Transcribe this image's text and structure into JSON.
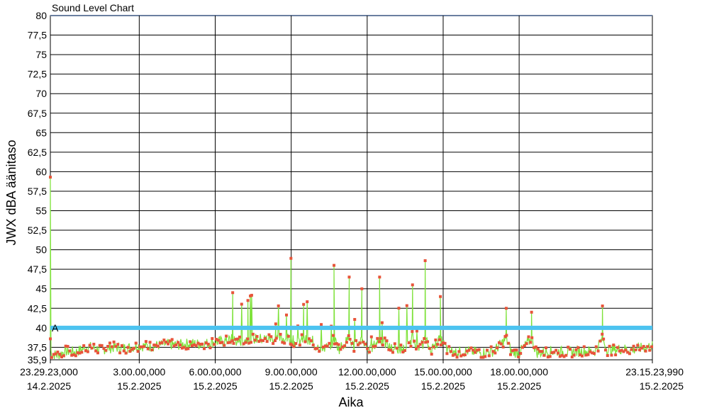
{
  "chart_data": {
    "type": "line",
    "title": "Sound Level Chart",
    "xlabel": "Aika",
    "ylabel": "JWX dBA äänitaso",
    "ylim": [
      35.9,
      80
    ],
    "y_ticks": [
      "80",
      "77,5",
      "75",
      "72,5",
      "70",
      "67,5",
      "65",
      "62,5",
      "60",
      "57,5",
      "55",
      "52,5",
      "50",
      "47,5",
      "45",
      "42,5",
      "40",
      "37,5",
      "35,9"
    ],
    "x_ticks": [
      {
        "time": "23.29.23,000",
        "date": "14.2.2025"
      },
      {
        "time": "3.00.00,000",
        "date": "15.2.2025"
      },
      {
        "time": "6.00.00,000",
        "date": "15.2.2025"
      },
      {
        "time": "9.00.00,000",
        "date": "15.2.2025"
      },
      {
        "time": "12.00.00,000",
        "date": "15.2.2025"
      },
      {
        "time": "15.00.00,000",
        "date": "15.2.2025"
      },
      {
        "time": "18.00.00,000",
        "date": "15.2.2025"
      },
      {
        "time": "23.15.23,990",
        "date": "15.2.2025"
      }
    ],
    "x_range_hours": [
      "23:29:23 14.2.2025",
      "23:15:24 15.2.2025"
    ],
    "grid": true,
    "threshold": {
      "label": "A",
      "value": 40,
      "color": "#4cc3f0"
    },
    "series": [
      {
        "color": "#7ee23a",
        "marker_color": "#e8543a",
        "values_description": "sampled dBA levels",
        "points": [
          [
            0.0,
            59.3
          ],
          [
            0.03,
            36.8
          ],
          [
            0.1,
            36.6
          ],
          [
            0.3,
            36.5
          ],
          [
            0.6,
            37.0
          ],
          [
            1.0,
            36.9
          ],
          [
            1.5,
            37.6
          ],
          [
            2.0,
            37.2
          ],
          [
            2.5,
            37.5
          ],
          [
            3.0,
            37.4
          ],
          [
            3.5,
            37.7
          ],
          [
            4.0,
            37.6
          ],
          [
            4.5,
            37.9
          ],
          [
            5.0,
            37.8
          ],
          [
            5.5,
            38.0
          ],
          [
            6.0,
            37.9
          ],
          [
            6.5,
            38.2
          ],
          [
            7.0,
            38.3
          ],
          [
            7.2,
            44.5
          ],
          [
            7.4,
            38.2
          ],
          [
            7.8,
            43.5
          ],
          [
            8.0,
            38.6
          ],
          [
            8.5,
            38.7
          ],
          [
            8.9,
            40.5
          ],
          [
            9.1,
            38.9
          ],
          [
            9.5,
            48.9
          ],
          [
            9.7,
            38.0
          ],
          [
            10.0,
            43.0
          ],
          [
            10.5,
            37.6
          ],
          [
            11.0,
            37.4
          ],
          [
            11.2,
            48.0
          ],
          [
            11.4,
            37.3
          ],
          [
            11.8,
            46.5
          ],
          [
            12.0,
            37.5
          ],
          [
            12.3,
            45.0
          ],
          [
            12.6,
            37.0
          ],
          [
            13.0,
            46.5
          ],
          [
            13.5,
            37.2
          ],
          [
            14.0,
            37.3
          ],
          [
            14.3,
            45.5
          ],
          [
            14.6,
            37.2
          ],
          [
            14.8,
            48.6
          ],
          [
            15.0,
            37.1
          ],
          [
            15.4,
            44.0
          ],
          [
            15.7,
            37.0
          ],
          [
            16.0,
            36.9
          ],
          [
            16.5,
            37.0
          ],
          [
            17.0,
            36.8
          ],
          [
            17.5,
            37.0
          ],
          [
            18.0,
            42.5
          ],
          [
            18.2,
            36.9
          ],
          [
            18.5,
            36.8
          ],
          [
            19.0,
            42.0
          ],
          [
            19.2,
            36.8
          ],
          [
            19.8,
            37.0
          ],
          [
            20.5,
            36.9
          ],
          [
            21.0,
            37.0
          ],
          [
            21.5,
            37.0
          ],
          [
            21.8,
            42.8
          ],
          [
            22.0,
            37.1
          ],
          [
            22.5,
            37.3
          ],
          [
            23.0,
            37.2
          ],
          [
            23.5,
            37.5
          ],
          [
            23.77,
            37.7
          ]
        ]
      }
    ]
  }
}
